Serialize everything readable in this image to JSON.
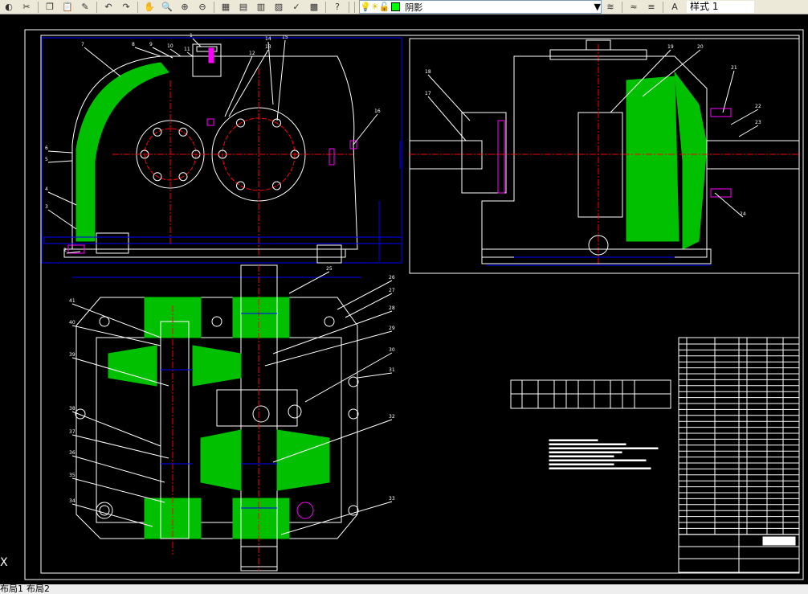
{
  "toolbar": {
    "layer_name": "阴影",
    "text_style": "样式 1",
    "icons": [
      "open-icon",
      "cut-icon",
      "copy-icon",
      "paste-icon",
      "match-properties-icon",
      "undo-icon",
      "redo-icon",
      "pan-icon",
      "zoom-realtime-icon",
      "zoom-window-icon",
      "zoom-previous-icon",
      "properties-icon",
      "design-center-icon",
      "tool-palettes-icon",
      "sheet-set-icon",
      "markup-icon",
      "calculator-icon",
      "help-icon",
      "layer-manager-icon",
      "layer-previous-icon",
      "layer-states-icon"
    ]
  },
  "layout_tabs": [
    "布局1",
    "布局2"
  ],
  "ucs_label": "X",
  "drawing": {
    "part_labels": [
      "1",
      "2",
      "3",
      "4",
      "5",
      "6",
      "7",
      "8",
      "9",
      "10",
      "11",
      "12",
      "13",
      "14",
      "15",
      "16",
      "17",
      "18",
      "19",
      "20",
      "21",
      "22",
      "23",
      "24",
      "25",
      "26",
      "27",
      "28",
      "29",
      "30",
      "31",
      "32",
      "33",
      "34",
      "35",
      "36",
      "37",
      "38",
      "39",
      "40",
      "41"
    ],
    "colors": {
      "outline": "#ffffff",
      "hatch": "#00c000",
      "center": "#ff0000",
      "dimension": "#0000ff",
      "fastener": "#ff00ff",
      "leader": "#ffffff"
    }
  }
}
